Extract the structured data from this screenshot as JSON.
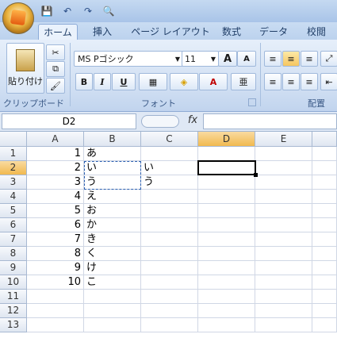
{
  "qat": {
    "save": "💾",
    "undo": "↶",
    "redo": "↷",
    "preview": "🔍"
  },
  "tabs": [
    "ホーム",
    "挿入",
    "ページ レイアウト",
    "数式",
    "データ",
    "校閲"
  ],
  "ribbon": {
    "paste_label": "貼り付け",
    "clipboard_group": "クリップボード",
    "font_name": "MS Pゴシック",
    "font_size": "11",
    "font_group": "フォント",
    "align_group": "配置",
    "bold": "B",
    "italic": "I",
    "underline": "U",
    "grow_font": "A",
    "shrink_font": "A",
    "font_color_glyph": "A",
    "phonetic": "亜"
  },
  "formula_bar": {
    "name_box": "D2",
    "fx": "fx",
    "value": ""
  },
  "columns": [
    "A",
    "B",
    "C",
    "D",
    "E"
  ],
  "rows": [
    "1",
    "2",
    "3",
    "4",
    "5",
    "6",
    "7",
    "8",
    "9",
    "10",
    "11",
    "12",
    "13"
  ],
  "cells": [
    {
      "a": "1",
      "b": "あ",
      "c": ""
    },
    {
      "a": "2",
      "b": "い",
      "c": "い"
    },
    {
      "a": "3",
      "b": "う",
      "c": "う"
    },
    {
      "a": "4",
      "b": "え",
      "c": ""
    },
    {
      "a": "5",
      "b": "お",
      "c": ""
    },
    {
      "a": "6",
      "b": "か",
      "c": ""
    },
    {
      "a": "7",
      "b": "き",
      "c": ""
    },
    {
      "a": "8",
      "b": "く",
      "c": ""
    },
    {
      "a": "9",
      "b": "け",
      "c": ""
    },
    {
      "a": "10",
      "b": "こ",
      "c": ""
    },
    {
      "a": "",
      "b": "",
      "c": ""
    },
    {
      "a": "",
      "b": "",
      "c": ""
    },
    {
      "a": "",
      "b": "",
      "c": ""
    }
  ],
  "selected_cell": "D2"
}
